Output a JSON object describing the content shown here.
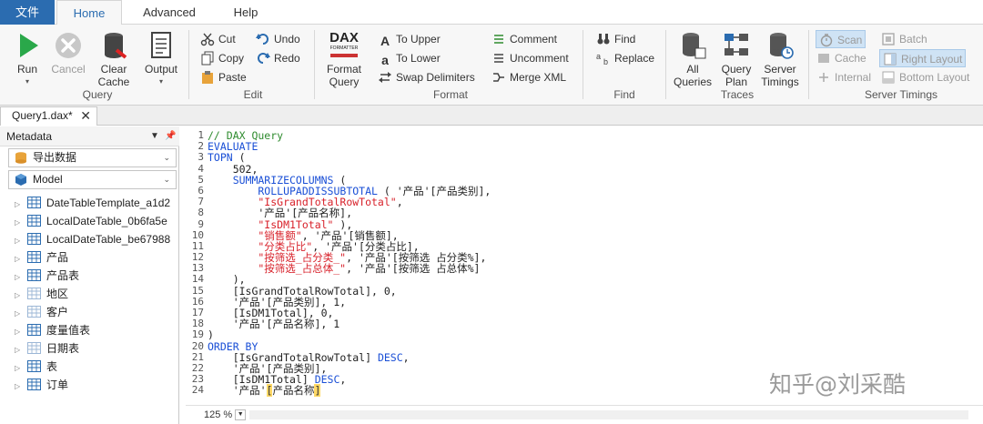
{
  "tabs": {
    "file": "文件",
    "home": "Home",
    "advanced": "Advanced",
    "help": "Help"
  },
  "ribbon": {
    "query": {
      "label": "Query",
      "run": "Run",
      "cancel": "Cancel",
      "clear_cache_1": "Clear",
      "clear_cache_2": "Cache",
      "output": "Output"
    },
    "edit": {
      "label": "Edit",
      "cut": "Cut",
      "copy": "Copy",
      "paste": "Paste",
      "undo": "Undo",
      "redo": "Redo"
    },
    "format": {
      "label": "Format",
      "dax_logo_1": "DAX",
      "dax_logo_2": "FORMATTER",
      "format_query_1": "Format",
      "format_query_2": "Query",
      "to_upper": "To Upper",
      "to_lower": "To Lower",
      "swap_delimiters": "Swap Delimiters",
      "comment": "Comment",
      "uncomment": "Uncomment",
      "merge_xml": "Merge XML"
    },
    "find": {
      "label": "Find",
      "find": "Find",
      "replace": "Replace"
    },
    "traces": {
      "label": "Traces",
      "all_queries_1": "All",
      "all_queries_2": "Queries",
      "query_plan_1": "Query",
      "query_plan_2": "Plan",
      "server_timings_1": "Server",
      "server_timings_2": "Timings"
    },
    "server_timings": {
      "label": "Server Timings",
      "scan": "Scan",
      "cache": "Cache",
      "internal": "Internal",
      "batch": "Batch",
      "right_layout": "Right Layout",
      "bottom_layout": "Bottom Layout"
    }
  },
  "document_tab": {
    "title": "Query1.dax*",
    "close": "✕"
  },
  "metadata": {
    "title": "Metadata",
    "database": "导出数据",
    "model": "Model",
    "tables": [
      "DateTableTemplate_a1d2",
      "LocalDateTable_0b6fa5e",
      "LocalDateTable_be67988",
      "产品",
      "产品表",
      "地区",
      "客户",
      "度量值表",
      "日期表",
      "表",
      "订单"
    ]
  },
  "editor": {
    "zoom": "125 %",
    "watermark": "知乎@刘采酷",
    "lines": [
      {
        "n": "1",
        "parts": [
          {
            "c": "cm",
            "t": "// DAX Query"
          }
        ]
      },
      {
        "n": "2",
        "parts": [
          {
            "c": "kw",
            "t": "EVALUATE"
          }
        ]
      },
      {
        "n": "3",
        "parts": [
          {
            "c": "kw",
            "t": "TOPN"
          },
          {
            "c": "tx",
            "t": " ("
          }
        ]
      },
      {
        "n": "4",
        "parts": [
          {
            "c": "tx",
            "t": "    502,"
          }
        ]
      },
      {
        "n": "5",
        "parts": [
          {
            "c": "kw",
            "t": "    SUMMARIZECOLUMNS"
          },
          {
            "c": "tx",
            "t": " ("
          }
        ]
      },
      {
        "n": "6",
        "parts": [
          {
            "c": "kw",
            "t": "        ROLLUPADDISSUBTOTAL"
          },
          {
            "c": "tx",
            "t": " ( '产品'[产品类别],"
          }
        ]
      },
      {
        "n": "7",
        "parts": [
          {
            "c": "str",
            "t": "        \"IsGrandTotalRowTotal\""
          },
          {
            "c": "tx",
            "t": ","
          }
        ]
      },
      {
        "n": "8",
        "parts": [
          {
            "c": "tx",
            "t": "        '产品'[产品名称],"
          }
        ]
      },
      {
        "n": "9",
        "parts": [
          {
            "c": "str",
            "t": "        \"IsDM1Total\""
          },
          {
            "c": "tx",
            "t": " ),"
          }
        ]
      },
      {
        "n": "10",
        "parts": [
          {
            "c": "str",
            "t": "        \"销售额\""
          },
          {
            "c": "tx",
            "t": ", '产品'[销售额],"
          }
        ]
      },
      {
        "n": "11",
        "parts": [
          {
            "c": "str",
            "t": "        \"分类占比\""
          },
          {
            "c": "tx",
            "t": ", '产品'[分类占比],"
          }
        ]
      },
      {
        "n": "12",
        "parts": [
          {
            "c": "str",
            "t": "        \"按筛选_占分类_\""
          },
          {
            "c": "tx",
            "t": ", '产品'[按筛选 占分类%],"
          }
        ]
      },
      {
        "n": "13",
        "parts": [
          {
            "c": "str",
            "t": "        \"按筛选_占总体_\""
          },
          {
            "c": "tx",
            "t": ", '产品'[按筛选 占总体%]"
          }
        ]
      },
      {
        "n": "14",
        "parts": [
          {
            "c": "tx",
            "t": "    ),"
          }
        ]
      },
      {
        "n": "15",
        "parts": [
          {
            "c": "tx",
            "t": "    [IsGrandTotalRowTotal], 0,"
          }
        ]
      },
      {
        "n": "16",
        "parts": [
          {
            "c": "tx",
            "t": "    '产品'[产品类别], 1,"
          }
        ]
      },
      {
        "n": "17",
        "parts": [
          {
            "c": "tx",
            "t": "    [IsDM1Total], 0,"
          }
        ]
      },
      {
        "n": "18",
        "parts": [
          {
            "c": "tx",
            "t": "    '产品'[产品名称], 1"
          }
        ]
      },
      {
        "n": "19",
        "parts": [
          {
            "c": "tx",
            "t": ")"
          }
        ]
      },
      {
        "n": "20",
        "parts": [
          {
            "c": "kw",
            "t": "ORDER BY"
          }
        ]
      },
      {
        "n": "21",
        "parts": [
          {
            "c": "tx",
            "t": "    [IsGrandTotalRowTotal] "
          },
          {
            "c": "kw",
            "t": "DESC"
          },
          {
            "c": "tx",
            "t": ","
          }
        ]
      },
      {
        "n": "22",
        "parts": [
          {
            "c": "tx",
            "t": "    '产品'[产品类别],"
          }
        ]
      },
      {
        "n": "23",
        "parts": [
          {
            "c": "tx",
            "t": "    [IsDM1Total] "
          },
          {
            "c": "kw",
            "t": "DESC"
          },
          {
            "c": "tx",
            "t": ","
          }
        ]
      },
      {
        "n": "24",
        "parts": [
          {
            "c": "tx",
            "t": "    '产品'"
          },
          {
            "c": "hl",
            "t": "["
          },
          {
            "c": "tx",
            "t": "产品名称"
          },
          {
            "c": "hl",
            "t": "]"
          }
        ]
      }
    ]
  }
}
